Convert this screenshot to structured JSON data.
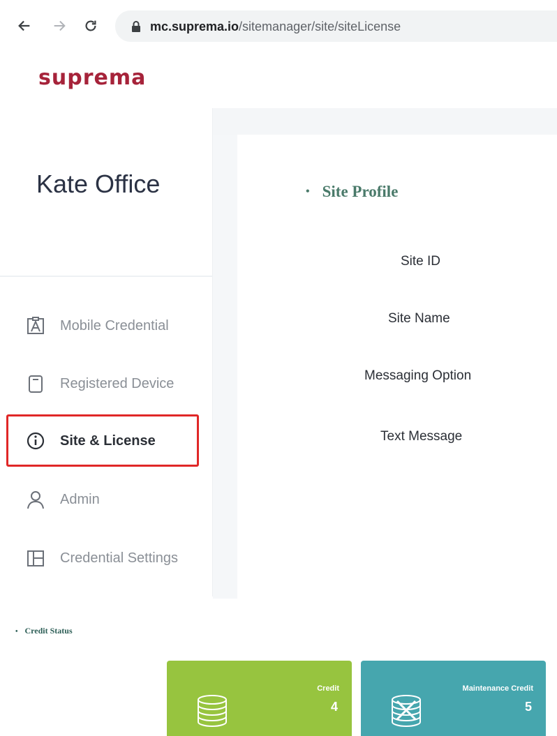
{
  "browser": {
    "url_host": "mc.suprema.io",
    "url_path": "/sitemanager/site/siteLicense"
  },
  "logo": "suprema",
  "sidebar": {
    "site_title": "Kate Office",
    "items": [
      {
        "label": "Mobile Credential",
        "icon": "id-badge-icon"
      },
      {
        "label": "Registered Device",
        "icon": "device-icon"
      },
      {
        "label": "Site & License",
        "icon": "info-icon",
        "active": true
      },
      {
        "label": "Admin",
        "icon": "user-icon"
      },
      {
        "label": "Credential Settings",
        "icon": "layout-icon"
      }
    ]
  },
  "main": {
    "section_title": "Site Profile",
    "fields": [
      "Site ID",
      "Site Name",
      "Messaging Option",
      "Text Message"
    ]
  },
  "credit": {
    "section_title": "Credit Status",
    "cards": [
      {
        "label": "Credit",
        "value": "4",
        "color": "#97c43f"
      },
      {
        "label": "Maintenance Credit",
        "value": "5",
        "color": "#46a6ae"
      }
    ]
  }
}
